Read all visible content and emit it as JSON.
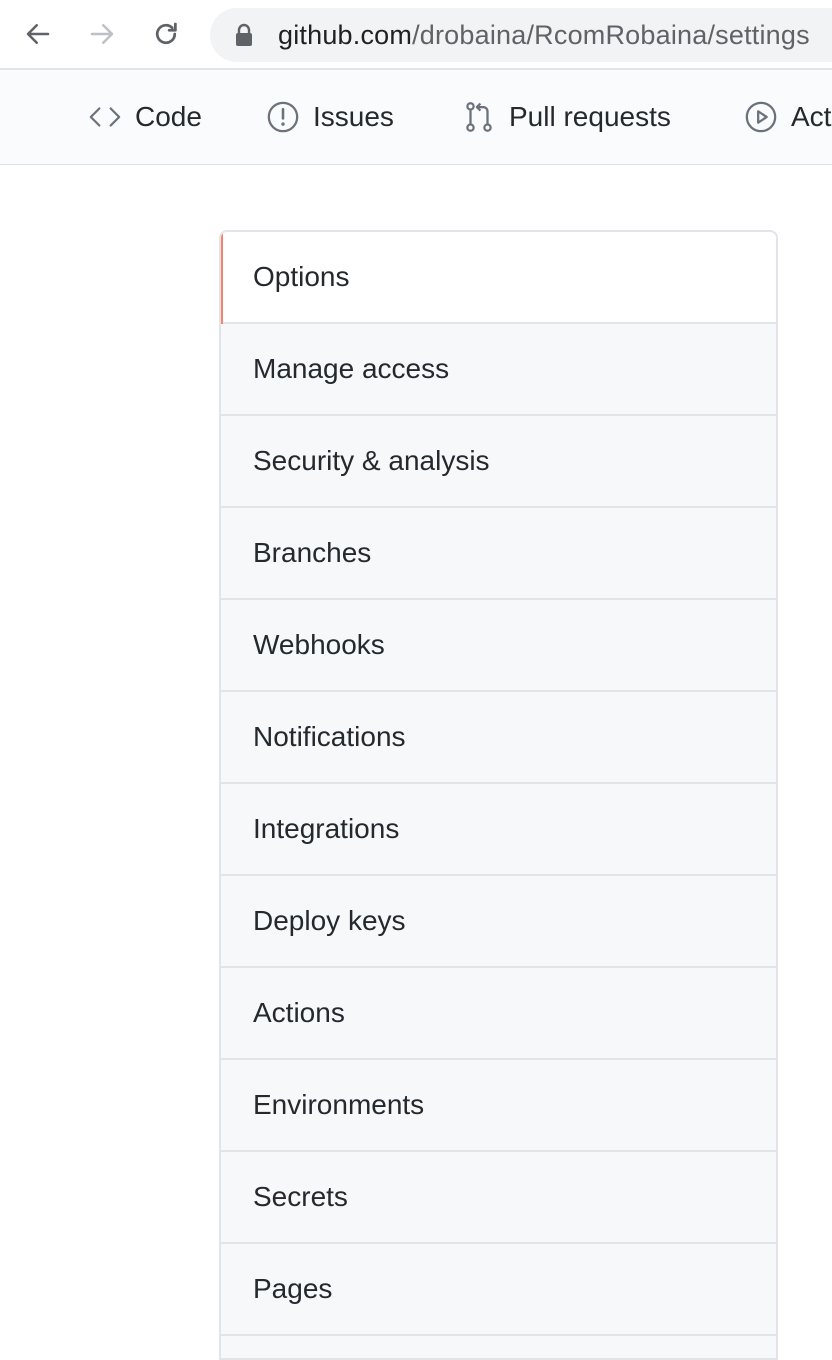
{
  "browser": {
    "url_host": "github.com",
    "url_path": "/drobaina/RcomRobaina/settings"
  },
  "repo_nav": {
    "tabs": [
      {
        "label": "Code",
        "icon": "code-icon"
      },
      {
        "label": "Issues",
        "icon": "issue-icon"
      },
      {
        "label": "Pull requests",
        "icon": "pull-request-icon"
      },
      {
        "label": "Actions",
        "icon": "play-icon"
      }
    ]
  },
  "settings_menu": {
    "selected": "Options",
    "accent_color": "#f9826c",
    "items": [
      {
        "label": "Options"
      },
      {
        "label": "Manage access"
      },
      {
        "label": "Security & analysis"
      },
      {
        "label": "Branches"
      },
      {
        "label": "Webhooks"
      },
      {
        "label": "Notifications"
      },
      {
        "label": "Integrations"
      },
      {
        "label": "Deploy keys"
      },
      {
        "label": "Actions"
      },
      {
        "label": "Environments"
      },
      {
        "label": "Secrets"
      },
      {
        "label": "Pages"
      }
    ]
  }
}
